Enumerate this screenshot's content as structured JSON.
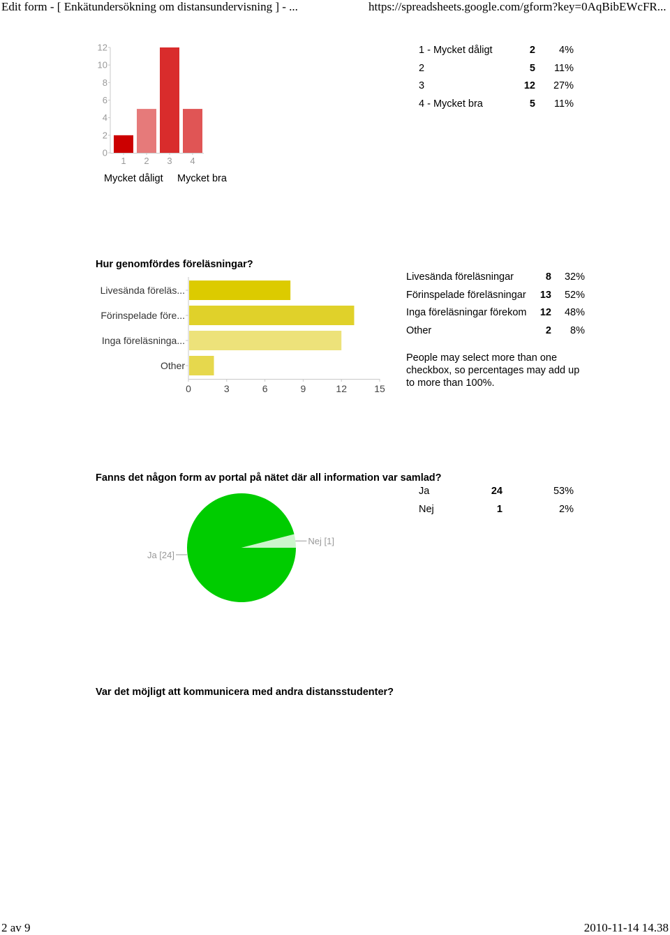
{
  "header": {
    "title": "Edit form - [ Enkätundersökning om distansundervisning ] - ...",
    "url": "https://spreadsheets.google.com/gform?key=0AqBibEWcFR..."
  },
  "footer": {
    "page": "2 av 9",
    "datetime": "2010-11-14 14.38"
  },
  "chart_data": [
    {
      "type": "bar",
      "title": "",
      "categories": [
        "1",
        "2",
        "3",
        "4"
      ],
      "values": [
        2,
        5,
        12,
        5
      ],
      "colors": [
        "#cc0000",
        "#e67a7a",
        "#d92c2c",
        "#e05555"
      ],
      "ylim": [
        0,
        12
      ],
      "yticks": [
        "0",
        "2",
        "4",
        "6",
        "8",
        "10",
        "12"
      ],
      "xlabel": "",
      "ylabel": "",
      "grid": false,
      "scale_labels": {
        "low": "Mycket dåligt",
        "high": "Mycket bra"
      },
      "table": [
        {
          "label": "1 -   Mycket dåligt",
          "count": "2",
          "percent": "4%"
        },
        {
          "label": "2",
          "count": "5",
          "percent": "11%"
        },
        {
          "label": "3",
          "count": "12",
          "percent": "27%"
        },
        {
          "label": "4 -   Mycket bra",
          "count": "5",
          "percent": "11%"
        }
      ]
    },
    {
      "type": "bar",
      "orientation": "horizontal",
      "title": "Hur genomfördes föreläsningar?",
      "categories": [
        "Livesända föreläs...",
        "Förinspelade före...",
        "Inga föreläsninga...",
        "Other"
      ],
      "values": [
        8,
        13,
        12,
        2
      ],
      "colors": [
        "#dccb00",
        "#e0d12a",
        "#ede27a",
        "#e6d84d"
      ],
      "xlim": [
        0,
        15
      ],
      "xticks": [
        "0",
        "3",
        "6",
        "9",
        "12",
        "15"
      ],
      "xlabel": "",
      "ylabel": "",
      "grid": false,
      "table": [
        {
          "label": "Livesända föreläsningar",
          "count": "8",
          "percent": "32%"
        },
        {
          "label": "Förinspelade föreläsningar",
          "count": "13",
          "percent": "52%"
        },
        {
          "label": "Inga föreläsningar förekom",
          "count": "12",
          "percent": "48%"
        },
        {
          "label": "Other",
          "count": "2",
          "percent": "8%"
        }
      ],
      "note": "People may select more than one checkbox, so percentages may add up to more than 100%."
    },
    {
      "type": "pie",
      "title": "Fanns det någon form av portal på nätet där all information var samlad?",
      "labels": [
        "Ja",
        "Nej"
      ],
      "values": [
        24,
        1
      ],
      "slice_labels": [
        "Ja [24]",
        "Nej [1]"
      ],
      "colors": [
        "#00cc00",
        "#ccf5cc"
      ],
      "table": [
        {
          "label": "Ja",
          "count": "24",
          "percent": "53%"
        },
        {
          "label": "Nej",
          "count": "1",
          "percent": "2%"
        }
      ]
    }
  ],
  "next_question": {
    "title": "Var det möjligt att kommunicera med andra distansstudenter?"
  }
}
